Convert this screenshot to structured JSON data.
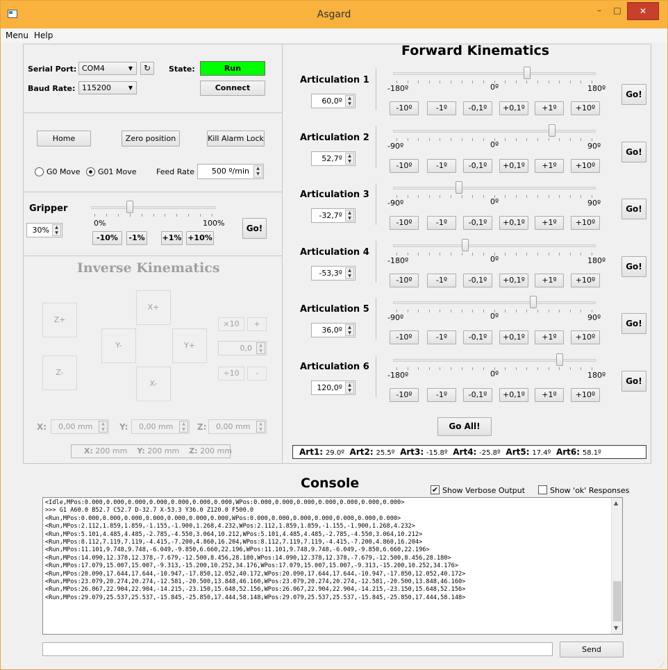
{
  "window": {
    "title": "Asgard",
    "minimize": "–",
    "maximize": "□",
    "close": "✕"
  },
  "menu": {
    "items": [
      "Menu",
      "Help"
    ]
  },
  "connection": {
    "serial_port_label": "Serial Port:",
    "serial_port_value": "COM4",
    "baud_rate_label": "Baud Rate:",
    "baud_rate_value": "115200",
    "state_label": "State:",
    "state_value": "Run",
    "state_color": "#00ff00",
    "connect_label": "Connect"
  },
  "controls": {
    "home_label": "Home",
    "zero_label": "Zero position",
    "kill_label": "Kill Alarm Lock",
    "g0_label": "G0 Move",
    "g01_label": "G01 Move",
    "selected_move": "G01 Move",
    "feed_label": "Feed Rate",
    "feed_value": "500 º/min"
  },
  "gripper": {
    "title": "Gripper",
    "value": "30%",
    "slider_fraction": 0.3,
    "min_label": "0%",
    "max_label": "100%",
    "go_label": "Go!",
    "buttons": [
      "-10%",
      "-1%",
      "+1%",
      "+10%"
    ]
  },
  "inverse": {
    "title": "Inverse Kinematics",
    "zplus": "Z+",
    "zminus": "Z-",
    "xplus": "X+",
    "xminus": "X-",
    "yminus": "Y-",
    "yplus": "Y+",
    "mult": "×10",
    "plus": "+",
    "step_value": "0,0",
    "div": "÷10",
    "minus": "-",
    "x_label": "X:",
    "x_value": "0,00 mm",
    "y_label": "Y:",
    "y_value": "0,00 mm",
    "z_label": "Z:",
    "z_value": "0,00 mm",
    "pos_x_label": "X:",
    "pos_x_value": "200 mm",
    "pos_y_label": "Y:",
    "pos_y_value": "200 mm",
    "pos_z_label": "Z:",
    "pos_z_value": "200 mm"
  },
  "forward": {
    "title": "Forward Kinematics",
    "step_buttons": [
      "-10º",
      "-1º",
      "-0,1º",
      "+0,1º",
      "+1º",
      "+10º"
    ],
    "go_label": "Go!",
    "go_all_label": "Go All!",
    "articulations": [
      {
        "label": "Articulation 1",
        "value": "60,0º",
        "min": "-180º",
        "zero": "0º",
        "max": "180º",
        "slider_fraction": 0.667
      },
      {
        "label": "Articulation 2",
        "value": "52,7º",
        "min": "-90º",
        "zero": "0º",
        "max": "90º",
        "slider_fraction": 0.793
      },
      {
        "label": "Articulation 3",
        "value": "-32,7º",
        "min": "-90º",
        "zero": "0º",
        "max": "90º",
        "slider_fraction": 0.318
      },
      {
        "label": "Articulation 4",
        "value": "-53,3º",
        "min": "-180º",
        "zero": "0º",
        "max": "180º",
        "slider_fraction": 0.352
      },
      {
        "label": "Articulation 5",
        "value": "36,0º",
        "min": "-90º",
        "zero": "0º",
        "max": "90º",
        "slider_fraction": 0.7
      },
      {
        "label": "Articulation 6",
        "value": "120,0º",
        "min": "-180º",
        "zero": "0º",
        "max": "180º",
        "slider_fraction": 0.833
      }
    ],
    "status": [
      {
        "label": "Art1:",
        "value": "29.0º"
      },
      {
        "label": "Art2:",
        "value": "25.5º"
      },
      {
        "label": "Art3:",
        "value": "-15.8º"
      },
      {
        "label": "Art4:",
        "value": "-25.8º"
      },
      {
        "label": "Art5:",
        "value": "17.4º"
      },
      {
        "label": "Art6:",
        "value": "58.1º"
      }
    ]
  },
  "console": {
    "title": "Console",
    "verbose_label": "Show Verbose Output",
    "verbose_checked": true,
    "ok_label": "Show 'ok' Responses",
    "ok_checked": false,
    "send_label": "Send",
    "input_value": "",
    "lines": [
      "<Idle,MPos:0.000,0.000,0.000,0.000,0.000,0.000,0.000,WPos:0.000,0.000,0.000,0.000,0.000,0.000,0.000>",
      ">>> G1 A60.0 B52.7 C52.7 D-32.7 X-53.3 Y36.0 Z120.0 F500.0",
      "<Run,MPos:0.000,0.000,0.000,0.000,0.000,0.000,0.000,WPos:0.000,0.000,0.000,0.000,0.000,0.000,0.000>",
      "<Run,MPos:2.112,1.859,1.859,-1.155,-1.900,1.268,4.232,WPos:2.112,1.859,1.859,-1.155,-1.900,1.268,4.232>",
      "<Run,MPos:5.101,4.485,4.485,-2.785,-4.550,3.064,10.212,WPos:5.101,4.485,4.485,-2.785,-4.550,3.064,10.212>",
      "<Run,MPos:8.112,7.119,7.119,-4.415,-7.200,4.860,16.204,WPos:8.112,7.119,7.119,-4.415,-7.200,4.860,16.204>",
      "<Run,MPos:11.101,9.748,9.748,-6.049,-9.850,6.660,22.196,WPos:11.101,9.748,9.748,-6.049,-9.850,6.660,22.196>",
      "<Run,MPos:14.090,12.378,12.378,-7.679,-12.500,8.456,28.180,WPos:14.090,12.378,12.378,-7.679,-12.500,8.456,28.180>",
      "<Run,MPos:17.079,15.007,15.007,-9.313,-15.200,10.252,34.176,WPos:17.079,15.007,15.007,-9.313,-15.200,10.252,34.176>",
      "<Run,MPos:20.090,17.644,17.644,-10.947,-17.850,12.052,40.172,WPos:20.090,17.644,17.644,-10.947,-17.850,12.052,40.172>",
      "<Run,MPos:23.079,20.274,20.274,-12.581,-20.500,13.848,46.160,WPos:23.079,20.274,20.274,-12.581,-20.500,13.848,46.160>",
      "<Run,MPos:26.067,22.904,22.904,-14.215,-23.150,15.648,52.156,WPos:26.067,22.904,22.904,-14.215,-23.150,15.648,52.156>",
      "<Run,MPos:29.079,25.537,25.537,-15.845,-25.850,17.444,58.148,WPos:29.079,25.537,25.537,-15.845,-25.850,17.444,58.148>"
    ]
  }
}
